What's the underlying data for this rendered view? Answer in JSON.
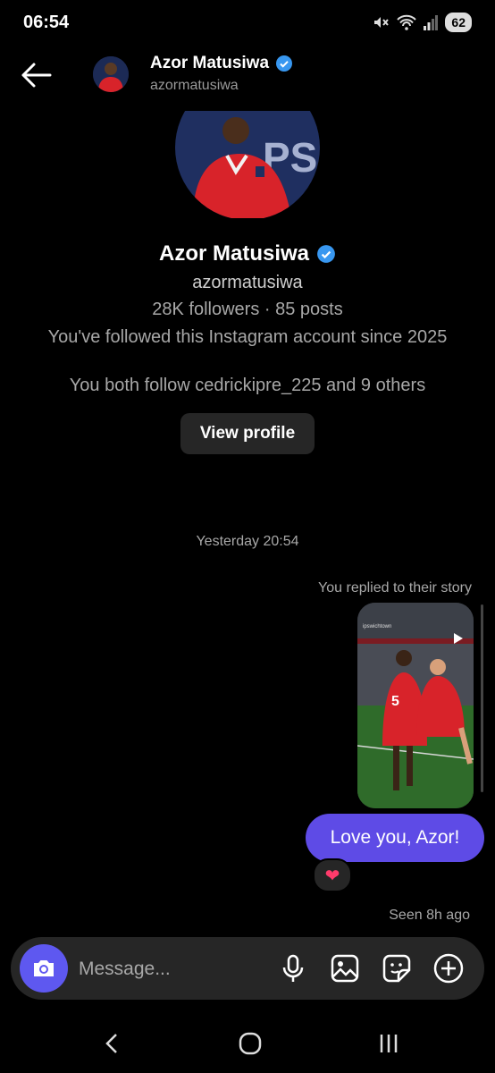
{
  "status_bar": {
    "time": "06:54",
    "battery": "62"
  },
  "header": {
    "name": "Azor Matusiwa",
    "handle": "azormatusiwa"
  },
  "profile": {
    "name": "Azor Matusiwa",
    "handle": "azormatusiwa",
    "stats": "28K followers · 85 posts",
    "followed_since": "You've followed this Instagram account since 2025",
    "mutual": "You both follow cedrickipre_225 and 9 others",
    "view_profile_label": "View profile"
  },
  "thread": {
    "timestamp": "Yesterday 20:54",
    "story_reply_note": "You replied to their story",
    "story_account": "ipswichtown",
    "message_text": "Love you, Azor!",
    "reaction": "❤",
    "seen_status": "Seen 8h ago"
  },
  "composer": {
    "placeholder": "Message..."
  },
  "colors": {
    "accent_bubble": "#5e4be6",
    "camera_button": "#5e58f0",
    "verified": "#3897f0",
    "jersey_red": "#d8232a"
  },
  "icons": [
    "back-arrow-icon",
    "verified-badge-icon",
    "camera-icon",
    "microphone-icon",
    "gallery-icon",
    "sticker-icon",
    "plus-icon",
    "nav-back-icon",
    "nav-home-icon",
    "nav-recents-icon",
    "mute-icon",
    "wifi-icon",
    "signal-icon"
  ]
}
